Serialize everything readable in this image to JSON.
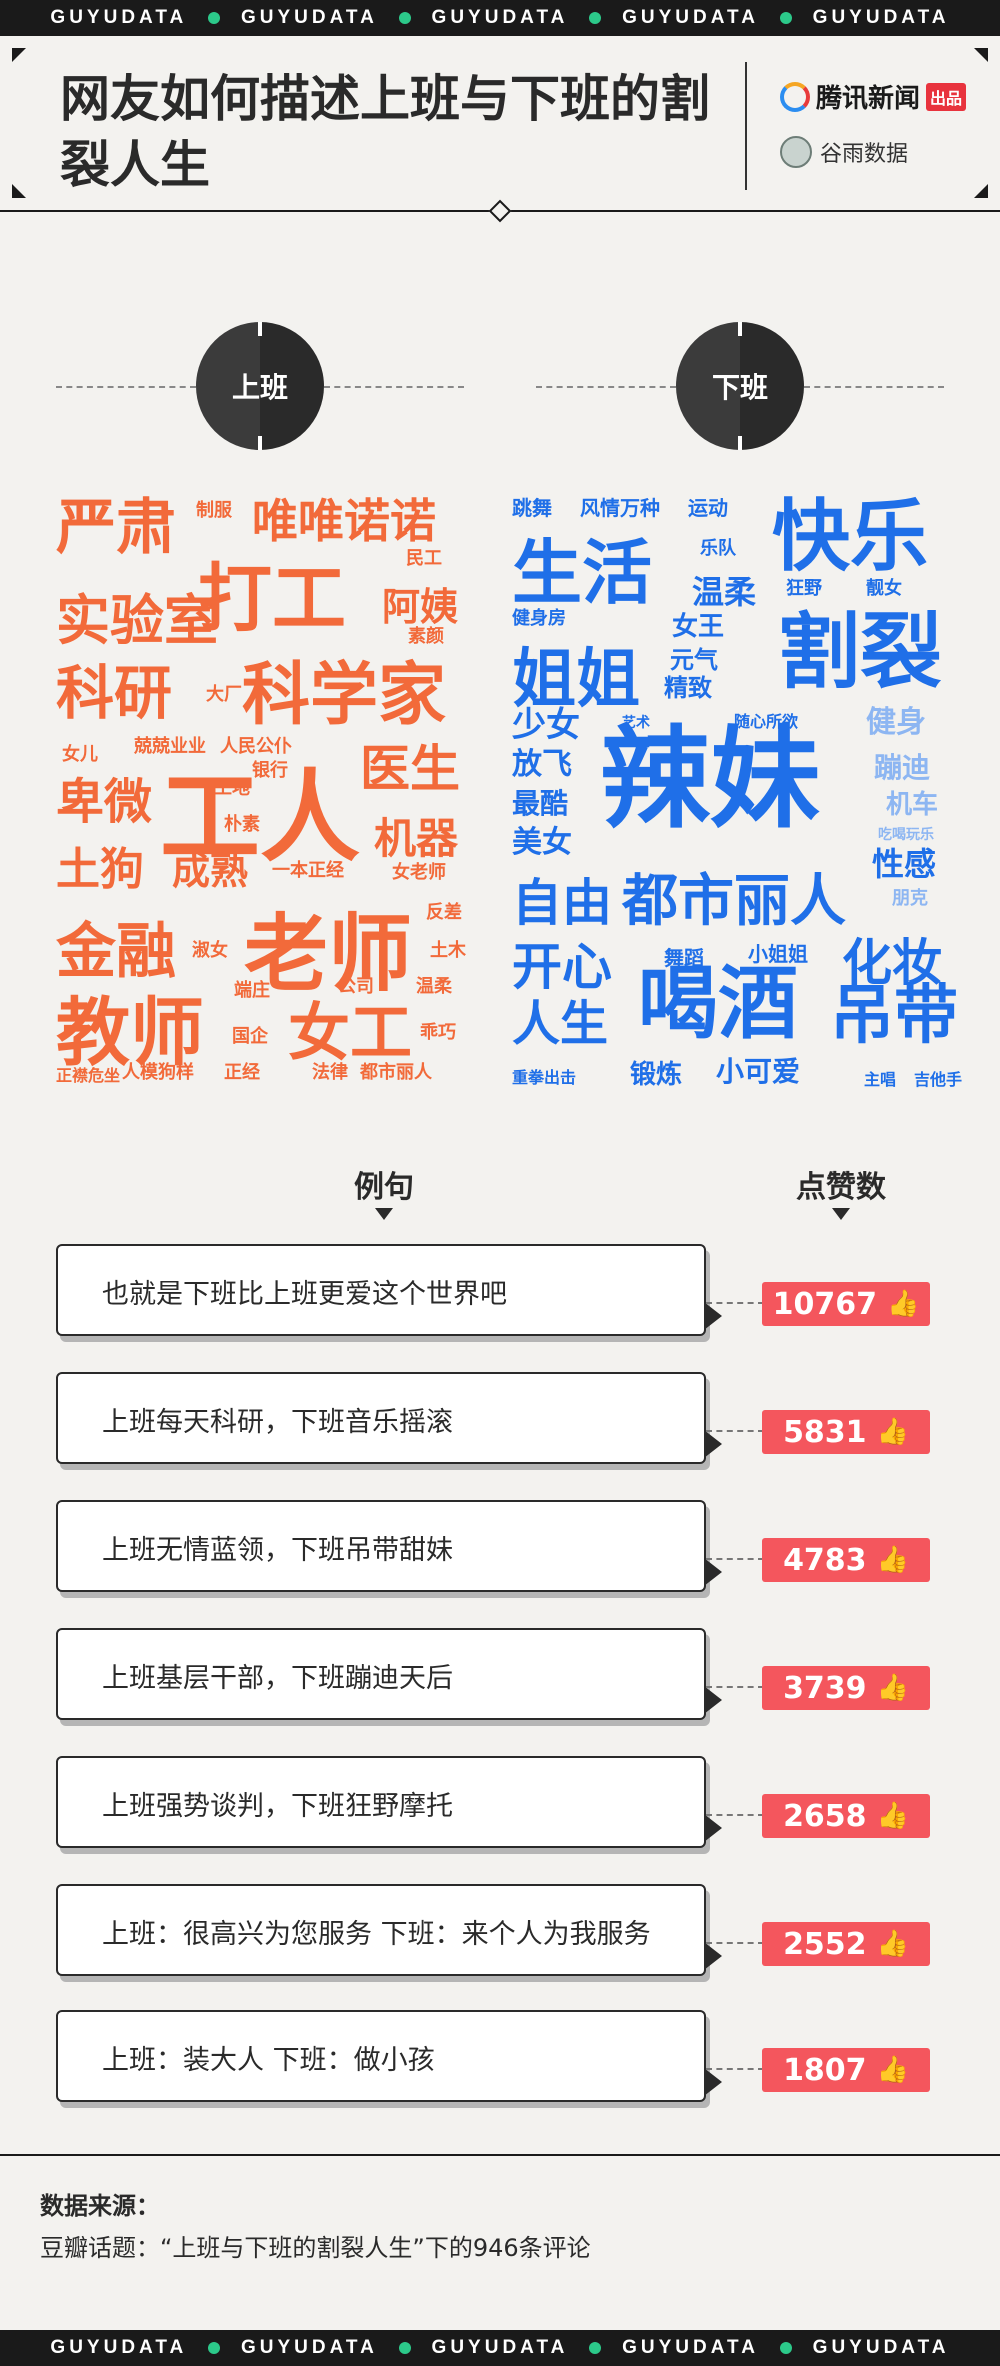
{
  "ticker": {
    "text": "GUYUDATA",
    "dot_color": "#2cc98a"
  },
  "header": {
    "title": "网友如何描述上班与下班的割裂人生",
    "logo_tencent": "腾讯新闻",
    "logo_tencent_badge": "出品",
    "logo_guyu": "谷雨数据"
  },
  "sides": {
    "on": "上班",
    "off": "下班"
  },
  "wordcloud_on": [
    "严肃",
    "制服",
    "唯唯诺诺",
    "民工",
    "实验室",
    "打工",
    "阿姨",
    "素颜",
    "科研",
    "大厂",
    "科学家",
    "女儿",
    "兢兢业业",
    "人民公仆",
    "银行",
    "卑微",
    "工地",
    "工人",
    "医生",
    "朴素",
    "机器",
    "土狗",
    "成熟",
    "一本正经",
    "女老师",
    "金融",
    "老师",
    "反差",
    "淑女",
    "土木",
    "端庄",
    "公司",
    "温柔",
    "教师",
    "国企",
    "女工",
    "乖巧",
    "正襟危坐",
    "人模狗样",
    "正经",
    "法律",
    "都市丽人"
  ],
  "wordcloud_off": [
    "跳舞",
    "风情万种",
    "运动",
    "快乐",
    "生活",
    "乐队",
    "温柔",
    "狂野",
    "靓女",
    "健身房",
    "女王",
    "割裂",
    "姐姐",
    "元气",
    "精致",
    "少女",
    "艺术",
    "随心所欲",
    "健身",
    "放飞",
    "辣妹",
    "蹦迪",
    "最酷",
    "机车",
    "吃喝玩乐",
    "美女",
    "性感",
    "自由",
    "都市丽人",
    "朋克",
    "舞蹈",
    "小姐姐",
    "化妆",
    "开心",
    "喝酒",
    "人生",
    "吊带",
    "重拳出击",
    "锻炼",
    "小可爱",
    "主唱",
    "吉他手"
  ],
  "labels": {
    "example": "例句",
    "likes": "点赞数"
  },
  "quotes": [
    {
      "text": "也就是下班比上班更爱这个世界吧",
      "likes": "10767"
    },
    {
      "text": "上班每天科研，下班音乐摇滚",
      "likes": "5831"
    },
    {
      "text": "上班无情蓝领，下班吊带甜妹",
      "likes": "4783"
    },
    {
      "text": "上班基层干部，下班蹦迪天后",
      "likes": "3739"
    },
    {
      "text": "上班强势谈判，下班狂野摩托",
      "likes": "2658"
    },
    {
      "text": "上班：很高兴为您服务 下班：来个人为我服务",
      "likes": "2552"
    },
    {
      "text": "上班：装大人 下班：做小孩",
      "likes": "1807"
    }
  ],
  "source": {
    "title": "数据来源：",
    "text": "豆瓣话题：“上班与下班的割裂人生”下的946条评论"
  },
  "colors": {
    "on": "#f26a3a",
    "off": "#1f6fe8",
    "likes_bg": "#f4565d"
  }
}
